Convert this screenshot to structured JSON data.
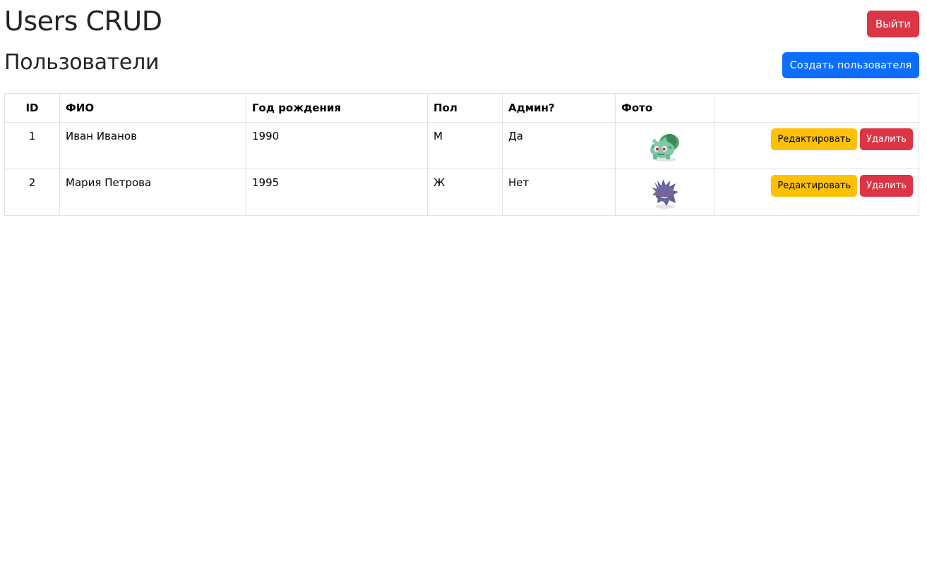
{
  "header": {
    "title": "Users CRUD",
    "logout_label": "Выйти"
  },
  "section": {
    "title": "Пользователи",
    "create_label": "Создать пользователя"
  },
  "table": {
    "columns": [
      "ID",
      "ФИО",
      "Год рождения",
      "Пол",
      "Админ?",
      "Фото",
      ""
    ],
    "rows": [
      {
        "id": "1",
        "fio": "Иван Иванов",
        "year": "1990",
        "sex": "М",
        "admin": "Да",
        "photo_icon": "bulbasaur-avatar-icon",
        "edit_label": "Редактировать",
        "delete_label": "Удалить"
      },
      {
        "id": "2",
        "fio": "Мария Петрова",
        "year": "1995",
        "sex": "Ж",
        "admin": "Нет",
        "photo_icon": "gengar-avatar-icon",
        "edit_label": "Редактировать",
        "delete_label": "Удалить"
      }
    ]
  },
  "colors": {
    "primary": "#0d6efd",
    "danger": "#dc3545",
    "warning": "#ffc107"
  }
}
